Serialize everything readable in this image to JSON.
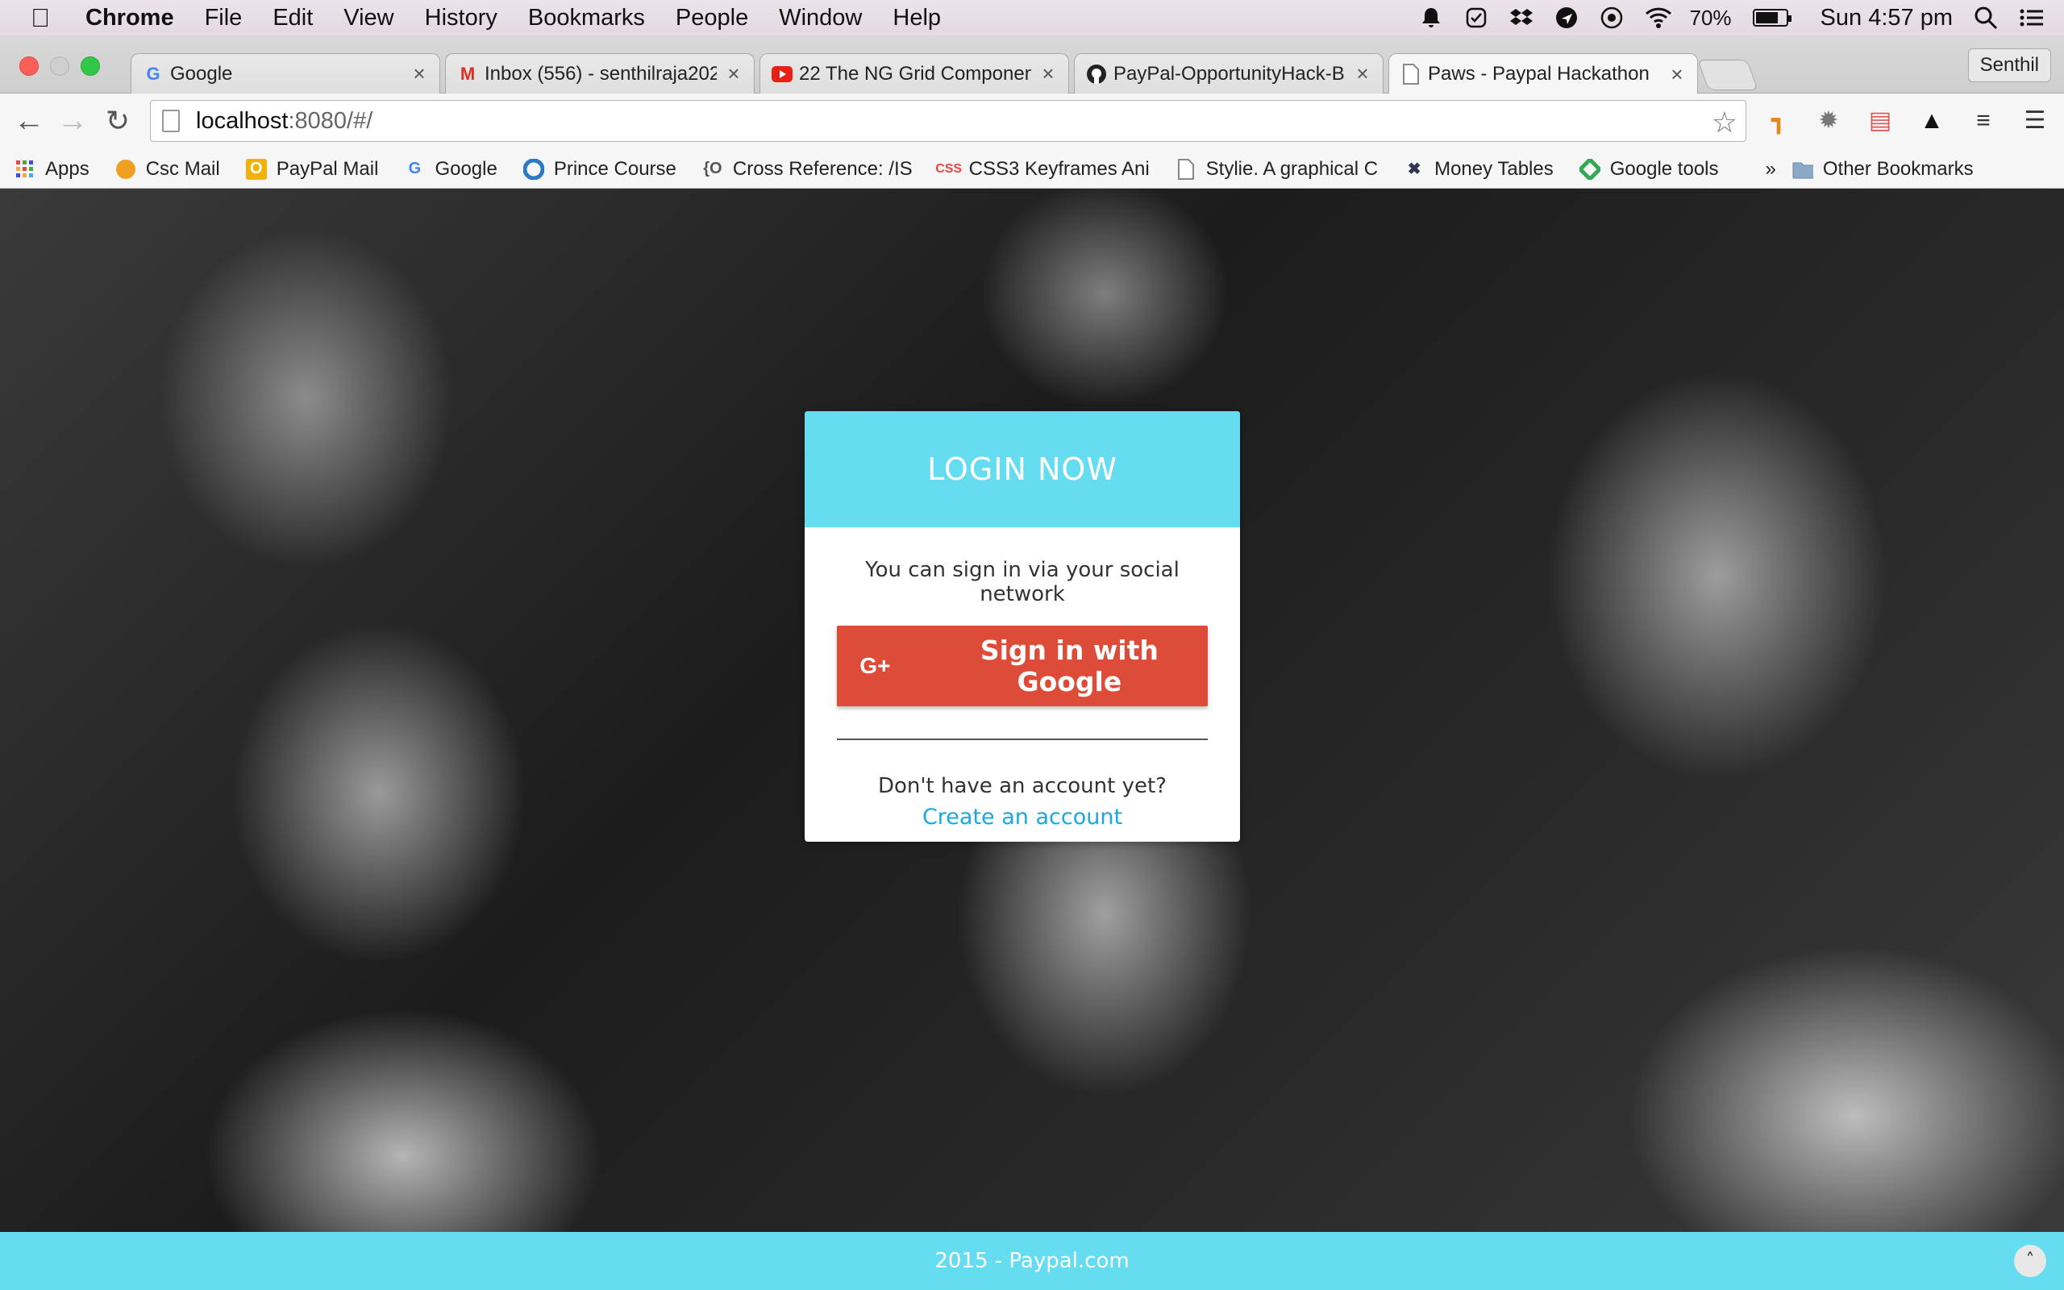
{
  "menubar": {
    "app_name": "Chrome",
    "items": [
      "File",
      "Edit",
      "View",
      "History",
      "Bookmarks",
      "People",
      "Window",
      "Help"
    ],
    "battery": "70%",
    "clock": "Sun 4:57 pm"
  },
  "tabs": [
    {
      "title": "Google",
      "favicon": "google-icon"
    },
    {
      "title": "Inbox (556) - senthilraja202",
      "favicon": "gmail-icon"
    },
    {
      "title": "22 The NG Grid Componen",
      "favicon": "youtube-icon"
    },
    {
      "title": "PayPal-OpportunityHack-B",
      "favicon": "github-icon"
    },
    {
      "title": "Paws - Paypal Hackathon",
      "favicon": "page-icon"
    }
  ],
  "profile_name": "Senthil",
  "omnibox": {
    "host": "localhost",
    "path": ":8080/#/"
  },
  "bookmarks": [
    {
      "label": "Apps",
      "icon": "apps-grid-icon"
    },
    {
      "label": "Csc Mail",
      "icon": "csc-mail-icon"
    },
    {
      "label": "PayPal Mail",
      "icon": "outlook-icon"
    },
    {
      "label": "Google",
      "icon": "google-icon"
    },
    {
      "label": "Prince Course",
      "icon": "prince-icon"
    },
    {
      "label": "Cross Reference: /IS",
      "icon": "cross-reference-icon"
    },
    {
      "label": "CSS3 Keyframes Ani",
      "icon": "css3-icon"
    },
    {
      "label": "Stylie. A graphical C",
      "icon": "page-icon"
    },
    {
      "label": "Money Tables",
      "icon": "money-tables-icon"
    },
    {
      "label": "Google tools",
      "icon": "google-tools-icon"
    },
    {
      "label": "»",
      "icon": ""
    },
    {
      "label": "Other Bookmarks",
      "icon": "folder-icon"
    }
  ],
  "login": {
    "header": "LOGIN NOW",
    "social_text": "You can sign in via your social network",
    "google_icon_text": "G+",
    "google_button": "Sign in with Google",
    "no_account": "Don't have an account yet?",
    "create_account": "Create an account"
  },
  "footer": {
    "text": "2015 - Paypal.com"
  },
  "colors": {
    "accent": "#65dcef",
    "google_red": "#dd4b39",
    "link": "#1ba8e0"
  }
}
